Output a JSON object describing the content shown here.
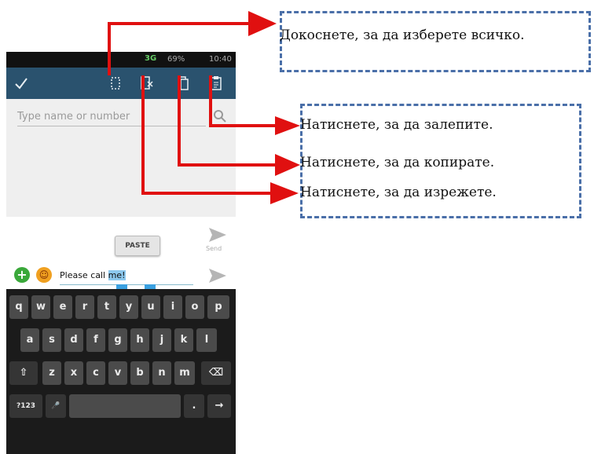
{
  "status_bar": {
    "signal": "3G",
    "battery": "69%",
    "time": "10:40"
  },
  "action_bar": {
    "done_icon": "checkmark-icon",
    "select_all_icon": "select-all-icon",
    "cut_icon": "cut-icon",
    "copy_icon": "copy-icon",
    "paste_icon": "paste-icon"
  },
  "recipient": {
    "placeholder": "Type name or number"
  },
  "compose": {
    "paste_popup": "PASTE",
    "send_label": "Send",
    "message_prefix": "Please call ",
    "message_selected": "me!"
  },
  "keyboard": {
    "row1": [
      "q",
      "w",
      "e",
      "r",
      "t",
      "y",
      "u",
      "i",
      "o",
      "p"
    ],
    "row2": [
      "a",
      "s",
      "d",
      "f",
      "g",
      "h",
      "j",
      "k",
      "l"
    ],
    "row3": [
      "z",
      "x",
      "c",
      "v",
      "b",
      "n",
      "m"
    ],
    "shift": "⇧",
    "backspace": "⌫",
    "symbols": "?123",
    "mic": "🎤",
    "period": ".",
    "enter": "→"
  },
  "annotations": {
    "select_all": "Докоснете, за да изберете всичко.",
    "paste": "Натиснете, за да залепите.",
    "copy": "Натиснете, за да копирате.",
    "cut": "Натиснете, за да изрежете."
  },
  "colors": {
    "arrow": "#e01010",
    "dash_border": "#4a6fa8",
    "action_bar": "#2a526e",
    "keyboard": "#1b1b1b"
  }
}
